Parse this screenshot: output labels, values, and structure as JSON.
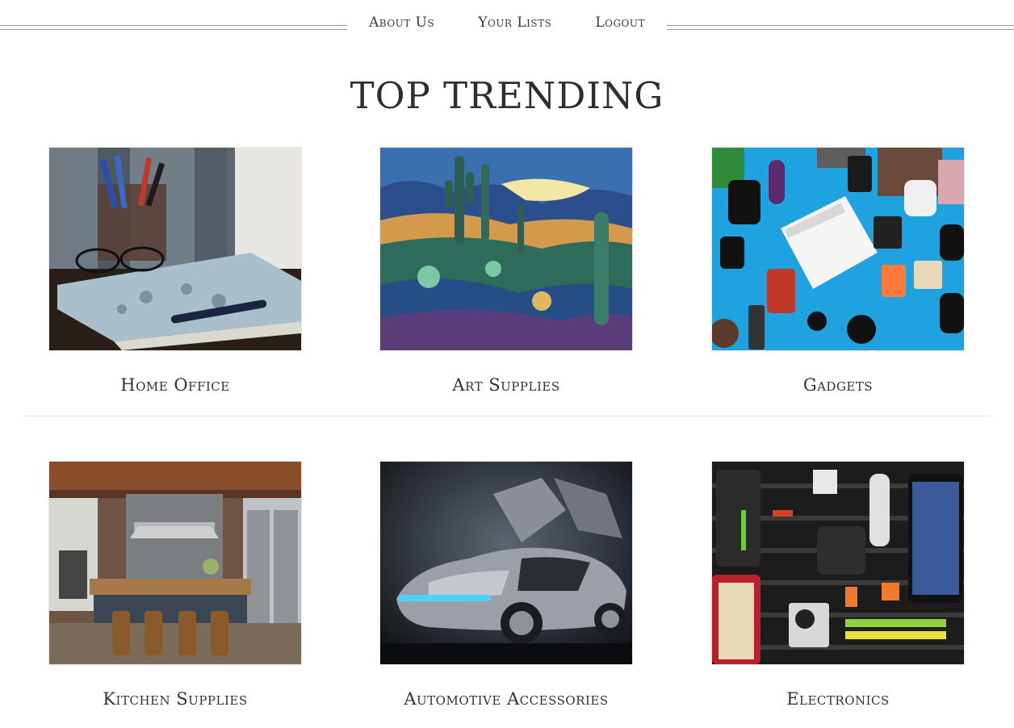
{
  "nav": {
    "items": [
      {
        "label": "About Us"
      },
      {
        "label": "Your Lists"
      },
      {
        "label": "Logout"
      }
    ]
  },
  "page": {
    "title": "TOP TRENDING"
  },
  "categories": [
    {
      "label": "Home Office",
      "image": "notebook-pen-cup-photo"
    },
    {
      "label": "Art Supplies",
      "image": "cactus-painting-photo"
    },
    {
      "label": "Gadgets",
      "image": "gadgets-flatlay-photo"
    },
    {
      "label": "Kitchen Supplies",
      "image": "kitchen-island-photo"
    },
    {
      "label": "Automotive Accessories",
      "image": "silver-sports-car-photo"
    },
    {
      "label": "Electronics",
      "image": "cable-organizer-photo"
    }
  ],
  "colors": {
    "text": "#2b2b2b",
    "rule": "#9a9a9a",
    "divider": "#e3e3e3",
    "gadgets_bg": "#1fa2e0"
  }
}
